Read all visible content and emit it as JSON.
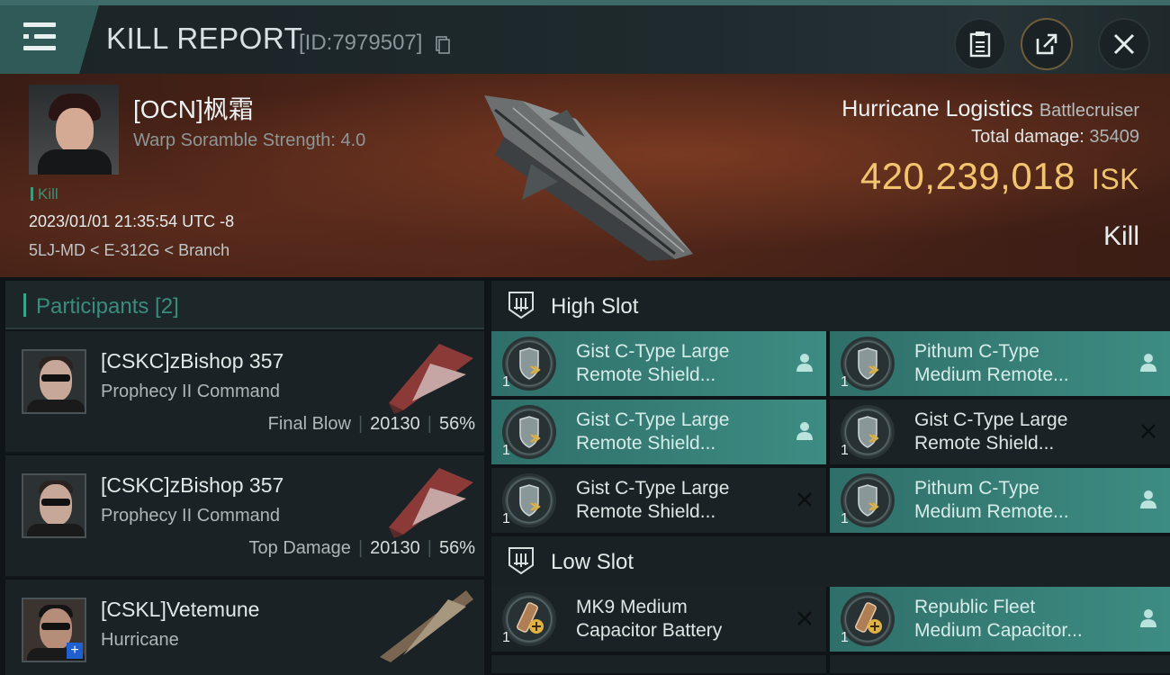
{
  "header": {
    "title": "KILL REPORT",
    "report_id": "[ID:7979507]"
  },
  "victim": {
    "name": "[OCN]枫霜",
    "warp_scramble": "Warp Soramble Strength: 4.0",
    "tag": "Kill",
    "datetime": "2023/01/01 21:35:54 UTC -8",
    "location": "5LJ-MD < E-312G < Branch",
    "ship": "Hurricane Logistics",
    "ship_class": "Battlecruiser",
    "total_damage_label": "Total damage:",
    "total_damage": "35409",
    "isk_value": "420,239,018",
    "isk_unit": "ISK",
    "result": "Kill"
  },
  "participants": {
    "label": "Participants [2]",
    "rows": [
      {
        "name": "[CSKC]zBishop 357",
        "ship": "Prophecy II Command",
        "role": "Final Blow",
        "damage": "20130",
        "percent": "56%"
      },
      {
        "name": "[CSKC]zBishop 357",
        "ship": "Prophecy II Command",
        "role": "Top Damage",
        "damage": "20130",
        "percent": "56%"
      },
      {
        "name": "[CSKL]Vetemune",
        "ship": "Hurricane"
      }
    ]
  },
  "high_slot": {
    "title": "High Slot",
    "modules": [
      {
        "line1": "Gist C-Type Large",
        "line2": "Remote Shield...",
        "qty": "1",
        "state": "dropped"
      },
      {
        "line1": "Pithum C-Type",
        "line2": "Medium Remote...",
        "qty": "1",
        "state": "dropped"
      },
      {
        "line1": "Gist C-Type Large",
        "line2": "Remote Shield...",
        "qty": "1",
        "state": "dropped"
      },
      {
        "line1": "Gist C-Type Large",
        "line2": "Remote Shield...",
        "qty": "1",
        "state": "destroyed"
      },
      {
        "line1": "Gist C-Type Large",
        "line2": "Remote Shield...",
        "qty": "1",
        "state": "destroyed"
      },
      {
        "line1": "Pithum C-Type",
        "line2": "Medium Remote...",
        "qty": "1",
        "state": "dropped"
      }
    ]
  },
  "low_slot": {
    "title": "Low Slot",
    "modules": [
      {
        "line1": "MK9 Medium",
        "line2": "Capacitor Battery",
        "qty": "1",
        "state": "destroyed"
      },
      {
        "line1": "Republic Fleet",
        "line2": "Medium Capacitor...",
        "qty": "1",
        "state": "dropped"
      }
    ]
  },
  "colors": {
    "accent": "#3d8c83",
    "isk": "#f2c46e",
    "header_bar": "#2f5a57"
  }
}
